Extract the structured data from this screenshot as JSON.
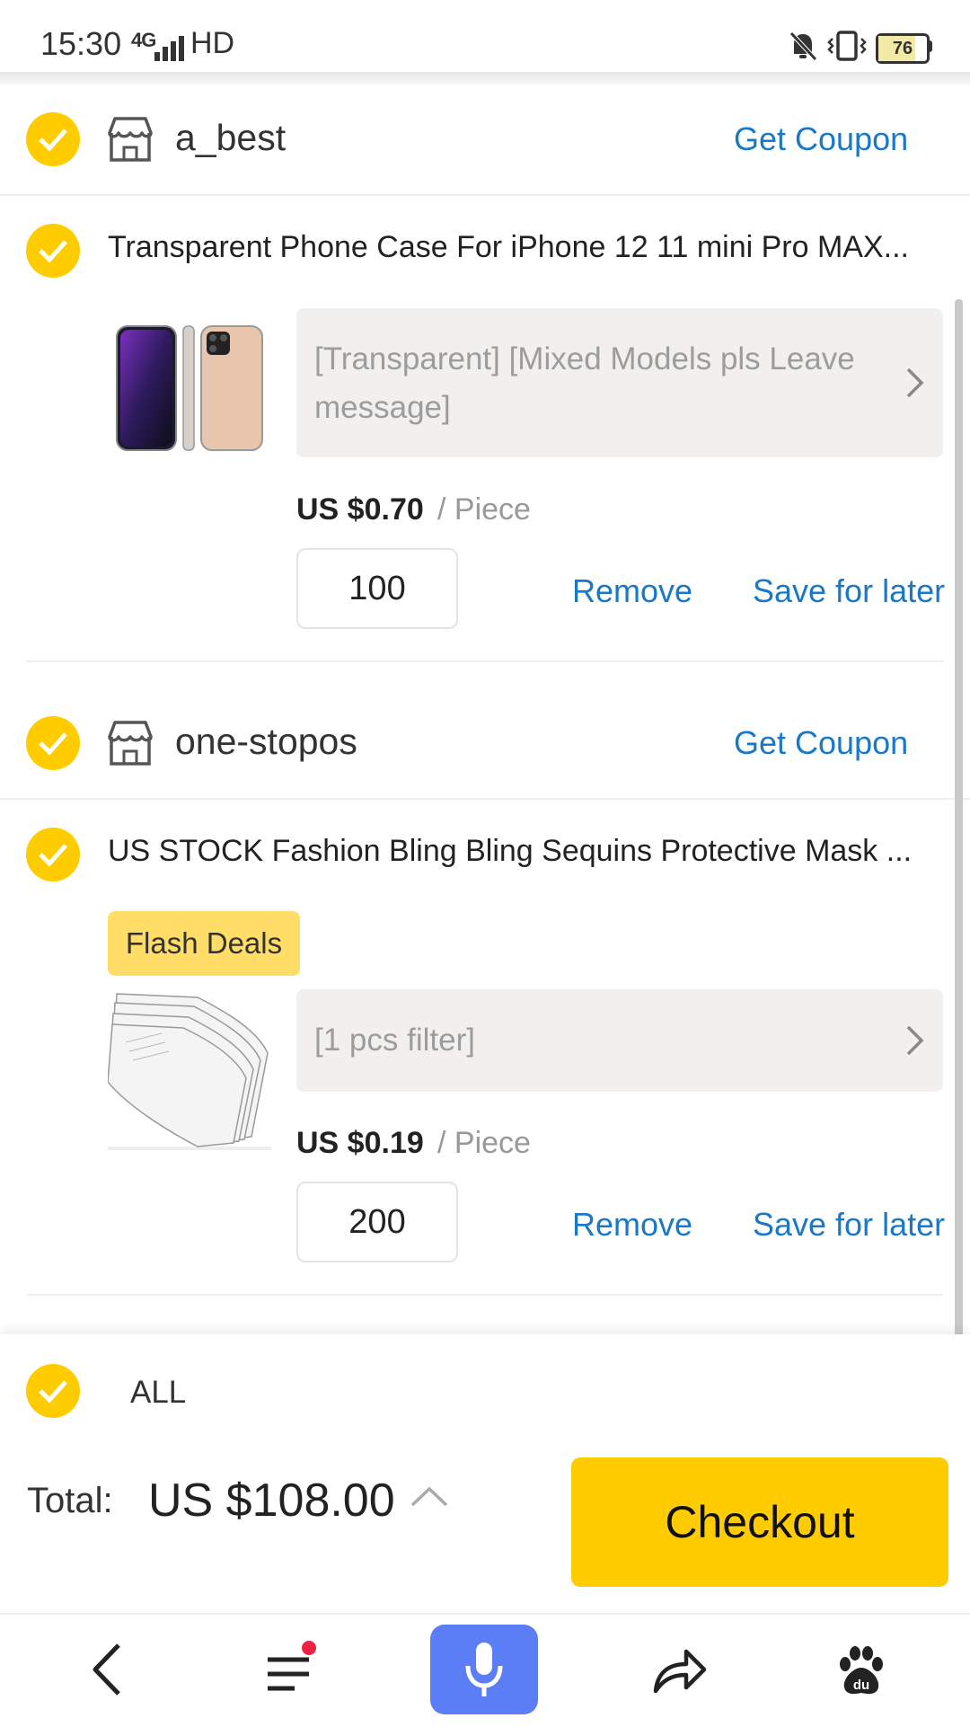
{
  "status_bar": {
    "time": "15:30",
    "network": "4G",
    "hd": "HD",
    "battery": "76"
  },
  "stores": [
    {
      "name": "a_best",
      "coupon_label": "Get Coupon",
      "item": {
        "title": "Transparent Phone Case For iPhone 12 11 mini Pro MAX...",
        "sku": "[Transparent] [Mixed Models pls Leave message]",
        "price": "US $0.70",
        "unit": "/ Piece",
        "quantity": "100",
        "remove_label": "Remove",
        "save_label": "Save for later"
      }
    },
    {
      "name": "one-stopos",
      "coupon_label": "Get Coupon",
      "item": {
        "badge": "Flash Deals",
        "title": "US STOCK Fashion Bling Bling Sequins Protective Mask ...",
        "sku": "[1 pcs filter]",
        "price": "US $0.19",
        "unit": "/ Piece",
        "quantity": "200",
        "remove_label": "Remove",
        "save_label": "Save for later"
      }
    }
  ],
  "footer": {
    "all_label": "ALL",
    "total_label": "Total:",
    "total_value": "US $108.00",
    "checkout_label": "Checkout"
  },
  "nav_bar": {
    "icons": [
      "back-icon",
      "menu-icon",
      "microphone-icon",
      "share-icon",
      "baidu-paw-icon"
    ]
  },
  "colors": {
    "accent_yellow": "#ffcc00",
    "link_blue": "#1a78c9",
    "mic_blue": "#5b7df5",
    "flash_badge": "#ffdd66"
  }
}
